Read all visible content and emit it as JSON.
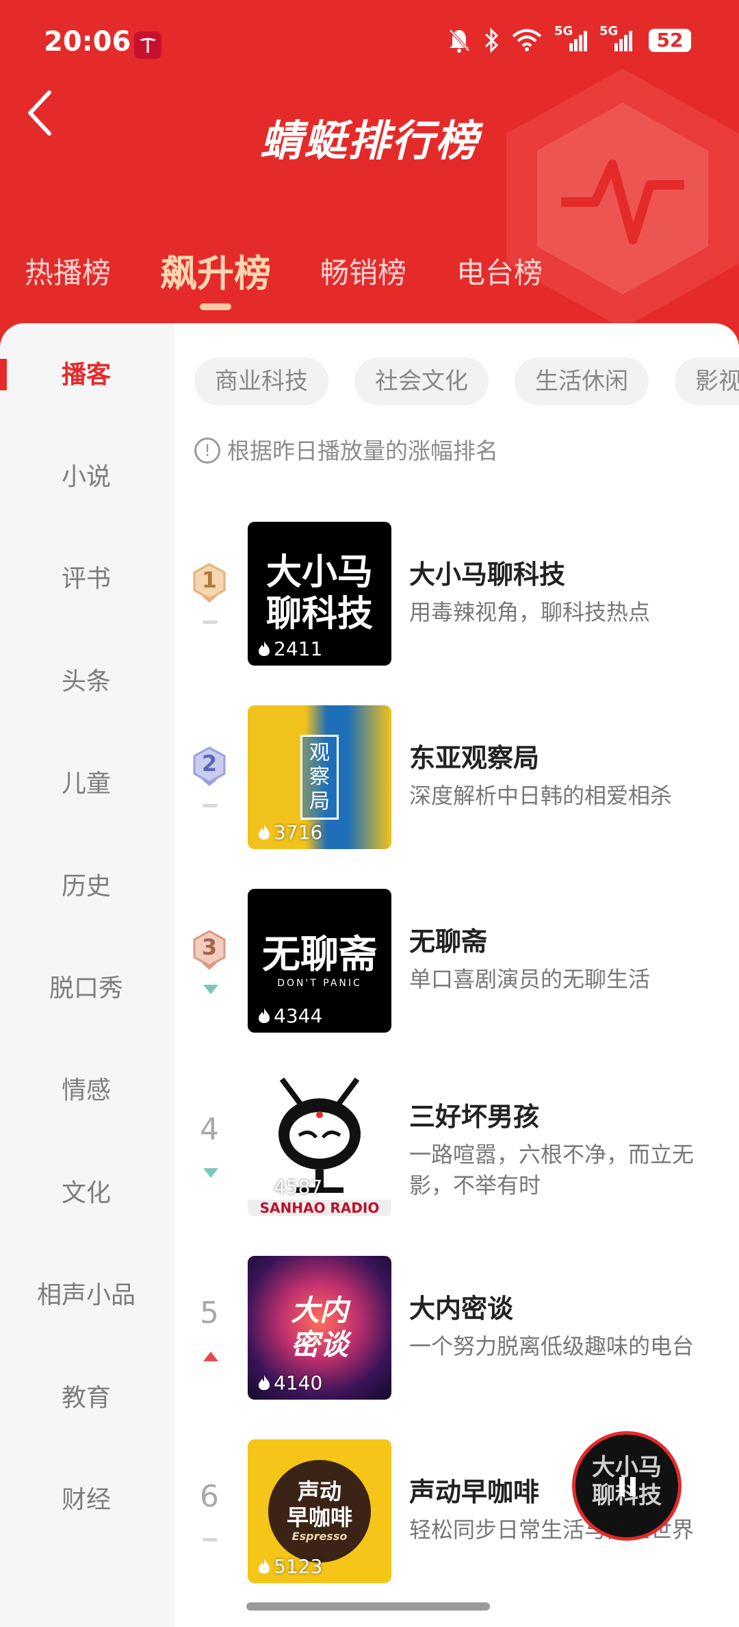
{
  "status_bar": {
    "time": "20:06",
    "network_1": "5G",
    "network_2": "5G",
    "battery": "52"
  },
  "header": {
    "title": "蜻蜓排行榜",
    "tabs": [
      {
        "label": "热播榜",
        "active": false
      },
      {
        "label": "飙升榜",
        "active": true
      },
      {
        "label": "畅销榜",
        "active": false
      },
      {
        "label": "电台榜",
        "active": false
      }
    ],
    "accent_color": "#e52a2a"
  },
  "sidebar": {
    "items": [
      {
        "label": "播客",
        "active": true
      },
      {
        "label": "小说"
      },
      {
        "label": "评书"
      },
      {
        "label": "头条"
      },
      {
        "label": "儿童"
      },
      {
        "label": "历史"
      },
      {
        "label": "脱口秀"
      },
      {
        "label": "情感"
      },
      {
        "label": "文化"
      },
      {
        "label": "相声小品"
      },
      {
        "label": "教育"
      },
      {
        "label": "财经"
      }
    ]
  },
  "filter_chips": [
    "商业科技",
    "社会文化",
    "生活休闲",
    "影视"
  ],
  "hint": "根据昨日播放量的涨幅排名",
  "rankings": [
    {
      "rank": "1",
      "trend": "flat",
      "title": "大小马聊科技",
      "description": "用毒辣视角，聊科技热点",
      "plays": "2411",
      "cover_text": "大小马\n聊科技"
    },
    {
      "rank": "2",
      "trend": "flat",
      "title": "东亚观察局",
      "description": "深度解析中日韩的相爱相杀",
      "plays": "3716",
      "cover_text": "观\n察\n局"
    },
    {
      "rank": "3",
      "trend": "down",
      "title": "无聊斋",
      "description": "单口喜剧演员的无聊生活",
      "plays": "4344",
      "cover_text": "无聊斋",
      "cover_subtext": "DON'T PANIC"
    },
    {
      "rank": "4",
      "trend": "down",
      "title": "三好坏男孩",
      "description": "一路喧嚣，六根不净，而立无影，不举有时",
      "plays": "4587",
      "cover_text": "SANHAO RADIO"
    },
    {
      "rank": "5",
      "trend": "up",
      "title": "大内密谈",
      "description": "一个努力脱离低级趣味的电台",
      "plays": "4140",
      "cover_text": "大内\n密谈"
    },
    {
      "rank": "6",
      "trend": "flat",
      "title": "声动早咖啡",
      "description": "轻松同步日常生活与商业世界",
      "plays": "5123",
      "cover_text": "声动\n早咖啡",
      "cover_subtext": "Espresso"
    }
  ],
  "mini_player": {
    "text": "大小马\n聊科技"
  }
}
